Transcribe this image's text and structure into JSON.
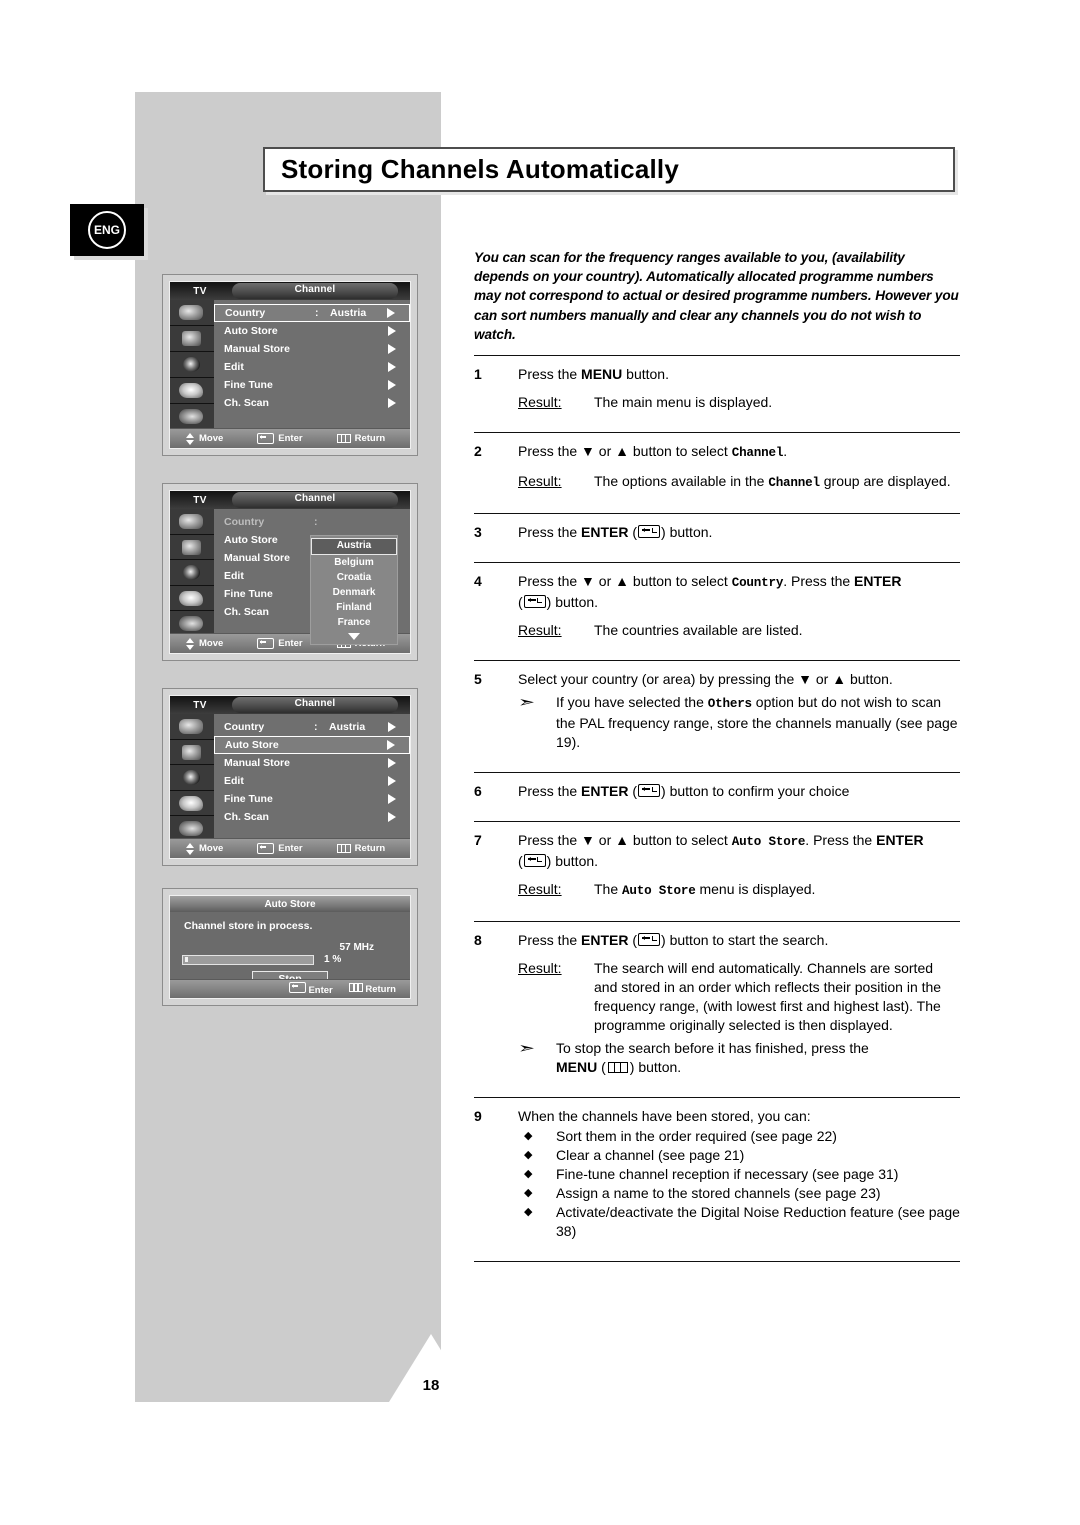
{
  "page": {
    "title": "Storing Channels Automatically",
    "language_badge": "ENG",
    "page_number": "18"
  },
  "intro": "You can scan for the frequency ranges available to you, (availability depends on your country). Automatically allocated programme numbers may not correspond to actual or desired programme numbers. However you can sort numbers manually and clear any channels you do not wish to watch.",
  "steps": [
    {
      "num": "1",
      "text_parts": [
        {
          "t": "Press the ",
          "s": "normal"
        },
        {
          "t": "MENU",
          "s": "bold"
        },
        {
          "t": " button.",
          "s": "normal"
        }
      ],
      "result_label": "Result:",
      "result_text": "The main menu is displayed."
    },
    {
      "num": "2",
      "result_label": "Result:",
      "result_text": "The options available in the Channel group are displayed."
    },
    {
      "num": "3"
    },
    {
      "num": "4",
      "result_label": "Result:",
      "result_text": "The countries available are listed."
    },
    {
      "num": "5",
      "note": "If you have selected the Others option but do not wish to scan the PAL frequency range, store the channels manually (see page 19)."
    },
    {
      "num": "6"
    },
    {
      "num": "7",
      "result_label": "Result:",
      "result_text": "The Auto Store menu is displayed."
    },
    {
      "num": "8",
      "result_label": "Result:",
      "result_text": "The search will end automatically. Channels are sorted and stored in an order which reflects their position in the frequency range, (with lowest first and highest last). The programme originally selected is then displayed.",
      "note": "To stop the search before it has finished, press the MENU ( ) button."
    },
    {
      "num": "9",
      "lead": "When the channels have been stored, you can:",
      "bullets": [
        "Sort them in the order required (see page 22)",
        "Clear a channel (see page 21)",
        "Fine-tune channel reception if necessary (see page 31)",
        "Assign a name to the stored channels (see page 23)",
        "Activate/deactivate the Digital Noise Reduction feature (see page 38)"
      ]
    }
  ],
  "step_text": {
    "s1_a": "Press the ",
    "s1_menu": "MENU",
    "s1_b": " button.",
    "s2_a": "Press the ",
    "s2_down": "▼",
    "s2_or": " or ",
    "s2_up": "▲",
    "s2_b": " button to select ",
    "s2_target": "Channel",
    "s2_c": ".",
    "s2_res_a": "The options available in the ",
    "s2_res_target": "Channel",
    "s2_res_b": " group are displayed.",
    "s3_a": "Press the ",
    "s3_enter": "ENTER",
    "s3_b": "(",
    "s3_c": ") button.",
    "s4_a": "Press the ",
    "s4_b": " button to select ",
    "s4_target": "Country",
    "s4_c": ". Press the ",
    "s4_enter": "ENTER",
    "s4_d": "(",
    "s4_e": ") button.",
    "s4_res": "The countries available are listed.",
    "s5_a": "Select your country (or area) by pressing the ",
    "s5_b": " button.",
    "s5_note_a": "If you have selected the ",
    "s5_note_target": "Others",
    "s5_note_b": " option but do not wish to scan the PAL frequency range, store the channels manually (see page 19).",
    "s6_a": "Press the ",
    "s6_enter": "ENTER",
    "s6_b": "(",
    "s6_c": ") button to confirm your choice",
    "s7_a": "Press the ",
    "s7_b": " button to select ",
    "s7_target": "Auto Store",
    "s7_c": ". Press the ",
    "s7_enter": "ENTER",
    "s7_d": "(",
    "s7_e": ") button.",
    "s7_res_a": "The ",
    "s7_res_target": "Auto Store",
    "s7_res_b": " menu is displayed.",
    "s8_a": "Press the ",
    "s8_enter": "ENTER",
    "s8_b": "(",
    "s8_c": ") button to start the search.",
    "s8_res": "The search will end automatically. Channels are sorted and stored in an order which reflects their position in the frequency range, (with lowest first and highest last). The programme originally selected is then displayed.",
    "s8_note_a": "To stop the search before it has finished, press the",
    "s8_note_menu": "MENU",
    "s8_note_b": "(",
    "s8_note_c": ") button.",
    "result_label": "Result:",
    "s9_lead": "When the channels have been stored, you can:",
    "bullet_mark": "◆",
    "note_arrow": "➣"
  },
  "osd1": {
    "tv_label": "TV",
    "tab_label": "Channel",
    "rows": [
      {
        "label": "Country",
        "colon": ":",
        "value": "Austria",
        "selected": true
      },
      {
        "label": "Auto Store",
        "selected": false
      },
      {
        "label": "Manual Store",
        "selected": false
      },
      {
        "label": "Edit",
        "selected": false
      },
      {
        "label": "Fine Tune",
        "selected": false
      },
      {
        "label": "Ch. Scan",
        "selected": false
      }
    ],
    "footer": {
      "move": "Move",
      "enter": "Enter",
      "return": "Return"
    }
  },
  "osd2": {
    "tv_label": "TV",
    "tab_label": "Channel",
    "rows": [
      {
        "label": "Country",
        "colon": ":",
        "dim": true
      },
      {
        "label": "Auto Store"
      },
      {
        "label": "Manual Store"
      },
      {
        "label": "Edit"
      },
      {
        "label": "Fine Tune"
      },
      {
        "label": "Ch. Scan"
      }
    ],
    "dropdown": [
      {
        "name": "Austria",
        "selected": true
      },
      {
        "name": "Belgium",
        "selected": false
      },
      {
        "name": "Croatia",
        "selected": false
      },
      {
        "name": "Denmark",
        "selected": false
      },
      {
        "name": "Finland",
        "selected": false
      },
      {
        "name": "France",
        "selected": false
      }
    ],
    "footer": {
      "move": "Move",
      "enter": "Enter",
      "return": "Return"
    }
  },
  "osd3": {
    "tv_label": "TV",
    "tab_label": "Channel",
    "rows": [
      {
        "label": "Country",
        "colon": ":",
        "value": "Austria",
        "selected": false
      },
      {
        "label": "Auto Store",
        "selected": true
      },
      {
        "label": "Manual Store",
        "selected": false
      },
      {
        "label": "Edit",
        "selected": false
      },
      {
        "label": "Fine Tune",
        "selected": false
      },
      {
        "label": "Ch. Scan",
        "selected": false
      }
    ],
    "footer": {
      "move": "Move",
      "enter": "Enter",
      "return": "Return"
    }
  },
  "osd4": {
    "title": "Auto Store",
    "message": "Channel store in process.",
    "frequency": "57 MHz",
    "percent": "1 %",
    "progress_value": 1,
    "stop_label": "Stop",
    "footer": {
      "enter": "Enter",
      "return": "Return"
    }
  }
}
